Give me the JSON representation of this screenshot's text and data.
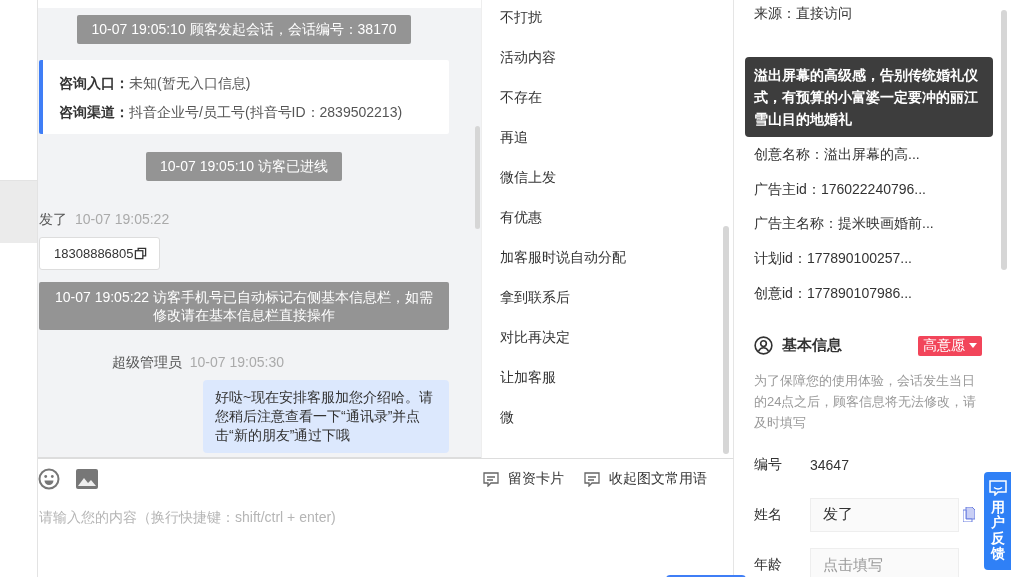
{
  "chat": {
    "messages": [
      {
        "kind": "system",
        "text": "10-07 19:05:10 顾客发起会话，会话编号：38170"
      },
      {
        "kind": "info",
        "lines": [
          {
            "label": "咨询入口：",
            "value": "未知(暂无入口信息)"
          },
          {
            "label": "咨询渠道：",
            "value": "抖音企业号/员工号(抖音号ID：2839502213)"
          }
        ]
      },
      {
        "kind": "system",
        "text": "10-07 19:05:10 访客已进线"
      },
      {
        "kind": "visitor",
        "sender": "发了",
        "time": "10-07 19:05:22",
        "text": "18308886805"
      },
      {
        "kind": "system_wide",
        "text": "10-07 19:05:22 访客手机号已自动标记右侧基本信息栏，如需修改请在基本信息栏直接操作"
      },
      {
        "kind": "agent",
        "sender": "超级管理员",
        "time": "10-07 19:05:30",
        "text": "好哒~现在安排客服加您介绍哈。请您稍后注意查看一下“通讯录”并点击“新的朋友”通过下哦"
      },
      {
        "kind": "system_cut"
      }
    ]
  },
  "quick_replies": [
    "不打扰",
    "活动内容",
    "不存在",
    "再追",
    "微信上发",
    "有优惠",
    "加客服时说自动分配",
    "拿到联系后",
    "对比再决定",
    "让加客服",
    "微"
  ],
  "composer": {
    "tools": [
      {
        "label": "留资卡片"
      },
      {
        "label": "收起图文常用语"
      }
    ],
    "placeholder": "请输入您的内容（换行快捷键：shift/ctrl + enter)"
  },
  "source_info": {
    "rows": [
      "来源：直接访问",
      "创意名称：溢出屏幕的高...",
      "广告主id：176022240796...",
      "广告主名称：提米映画婚前...",
      "计划id：177890100257...",
      "创意id：177890107986..."
    ],
    "tooltip": "溢出屏幕的高级感，告别传统婚礼仪式，有预算的小富婆一定要冲的丽江雪山目的地婚礼"
  },
  "basic_info": {
    "title": "基本信息",
    "intent_tag": "高意愿",
    "notice": "为了保障您的使用体验，会话发生当日的24点之后，顾客信息将无法修改，请及时填写",
    "fields": [
      {
        "kind": "text",
        "label": "编号",
        "value": "34647"
      },
      {
        "kind": "input",
        "label": "姓名",
        "value": "发了"
      },
      {
        "kind": "input",
        "label": "年龄",
        "placeholder": "点击填写"
      }
    ]
  },
  "feedback": {
    "label": "用户反馈"
  }
}
